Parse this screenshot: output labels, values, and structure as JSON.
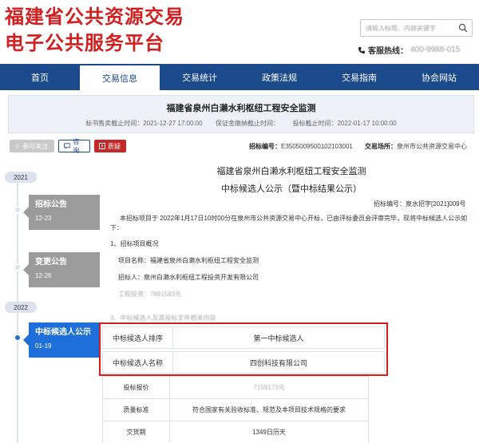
{
  "site": {
    "title_line1": "福建省公共资源交易",
    "title_line2": "电子公共服务平台",
    "search_placeholder": "请输入标题、内容关键字",
    "hotline_label": "客服热线：",
    "hotline_number": "400-9988-015"
  },
  "nav": {
    "items": [
      {
        "label": "首页"
      },
      {
        "label": "交易信息"
      },
      {
        "label": "交易统计"
      },
      {
        "label": "政策法规"
      },
      {
        "label": "交易指南"
      },
      {
        "label": "协会网站"
      }
    ],
    "active_index": 1
  },
  "project": {
    "title": "福建省泉州白濑水利枢纽工程安全监测",
    "sale_end_label": "标书售卖截止时间：",
    "sale_end": "2021-12-27 17:00:00",
    "deposit_end_label": "保证金缴纳截止时间：",
    "deposit_end": "",
    "bid_end_label": "投标截止时间：",
    "bid_end": "2022-01-17 10:00:00",
    "tender_no_label": "招标编号：",
    "tender_no": "E3505009500102103001",
    "venue_label": "交易场所：",
    "venue": "泉州市公共资源交易中心"
  },
  "actions": {
    "follow": "参与关注",
    "consult": "咨询",
    "doubt": "质疑"
  },
  "timeline": {
    "years": [
      "2021",
      "2022"
    ],
    "items": [
      {
        "title": "招标公告",
        "date": "12-23"
      },
      {
        "title": "变更公告",
        "date": "12-26"
      },
      {
        "title": "中标候选人公示",
        "date": "01-19"
      }
    ]
  },
  "doc": {
    "title_line1": "福建省泉州白濑水利枢纽工程安全监测",
    "title_line2": "中标候选人公示（暨中标结果公示）",
    "no": "招标编号：泉水招字[2021]009号",
    "para": "本招标项目于 2022年1月17日10时00分在泉州市公共资源交易中心开标，已由评标委员会评审完毕，现将中标候选人公示如下：",
    "sec1": "1、招标项目概况",
    "proj_name": "项目名称：福建省泉州白濑水利枢纽工程安全监测",
    "tenderer": "招标人：泉州白濑水利枢纽工程投资开发有限公司",
    "budget": "工程投资：7691583元",
    "sec3": "3、中标候选人及其投标文件相关内容"
  },
  "winner_table": {
    "rank_label": "中标候选人排序",
    "rank_value": "第一中标候选人",
    "name_label": "中标候选人名称",
    "name_value": "四创科技有限公司"
  },
  "detail_table": {
    "rows": [
      {
        "label": "投标报价",
        "value": "7159173元"
      },
      {
        "label": "质量标准",
        "value": "符合国家有关验收标准、规范及本项目技术规格的要求"
      },
      {
        "label": "交货期",
        "value": "1349日历天"
      }
    ]
  }
}
